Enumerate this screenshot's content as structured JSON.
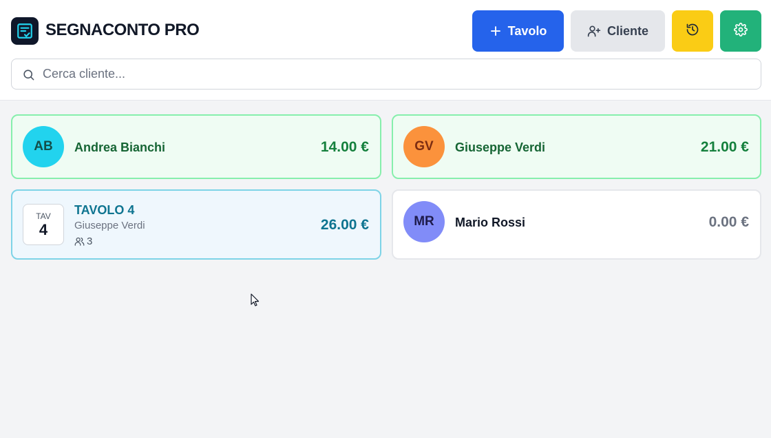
{
  "app": {
    "title": "SEGNACONTO PRO",
    "logo_icon": "receipt-check-icon"
  },
  "toolbar": {
    "add_table_label": "Tavolo",
    "add_table_icon": "plus-icon",
    "add_client_label": "Cliente",
    "add_client_icon": "user-plus-icon",
    "history_icon": "history-icon",
    "settings_icon": "gear-icon"
  },
  "search": {
    "placeholder": "Cerca cliente...",
    "value": ""
  },
  "cards": [
    {
      "type": "client",
      "initials": "AB",
      "name": "Andrea Bianchi",
      "amount": "14.00 €",
      "avatar_color": "#22d3ee",
      "status": "active"
    },
    {
      "type": "client",
      "initials": "GV",
      "name": "Giuseppe Verdi",
      "amount": "21.00 €",
      "avatar_color": "#fb923c",
      "status": "active"
    },
    {
      "type": "table",
      "tav_label": "TAV",
      "tav_number": "4",
      "title": "TAVOLO 4",
      "client": "Giuseppe Verdi",
      "guests": "3",
      "amount": "26.00 €",
      "guests_icon": "users-icon"
    },
    {
      "type": "client",
      "initials": "MR",
      "name": "Mario Rossi",
      "amount": "0.00 €",
      "avatar_color": "#818cf8",
      "status": "empty"
    }
  ],
  "colors": {
    "primary": "#2563eb",
    "history": "#facc15",
    "settings": "#22b27a",
    "active_card_bg": "#effcf3",
    "table_card_bg": "#eff7fd"
  }
}
